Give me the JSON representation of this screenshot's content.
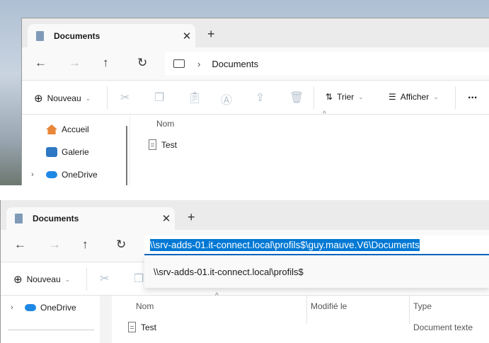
{
  "top": {
    "tab_title": "Documents",
    "breadcrumb": "Documents",
    "toolbar": {
      "new": "Nouveau",
      "sort": "Trier",
      "view": "Afficher",
      "more": "..."
    },
    "sidebar": [
      {
        "label": "Accueil"
      },
      {
        "label": "Galerie"
      },
      {
        "label": "OneDrive"
      }
    ],
    "columns": {
      "name": "Nom"
    },
    "files": [
      {
        "name": "Test"
      }
    ]
  },
  "bottom": {
    "tab_title": "Documents",
    "address_value": "\\\\srv-adds-01.it-connect.local\\profils$\\guy.mauve.V6\\Documents",
    "suggestion": "\\\\srv-adds-01.it-connect.local\\profils$",
    "toolbar": {
      "new": "Nouveau"
    },
    "sidebar": [
      {
        "label": "OneDrive"
      }
    ],
    "columns": {
      "name": "Nom",
      "modified": "Modifié le",
      "type": "Type"
    },
    "files": [
      {
        "name": "Test",
        "type": "Document texte"
      }
    ]
  },
  "colors": {
    "accent": "#0067c0",
    "selection": "#0078d4"
  }
}
